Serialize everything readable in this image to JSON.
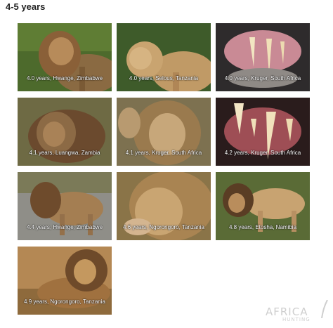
{
  "page": {
    "heading": "4-5 years"
  },
  "photos": [
    {
      "caption": "4.0 years, Hwange, Zimbabwe"
    },
    {
      "caption": "4.0 years, Selous, Tanzania"
    },
    {
      "caption": "4.0 years, Kruger, South Africa"
    },
    {
      "caption": "4.1 years, Luangwa, Zambia"
    },
    {
      "caption": "4.1 years, Kruger, South Africa"
    },
    {
      "caption": "4.2 years, Kruger, South Africa"
    },
    {
      "caption": "4.4 years, Hwange, Zimbabwe"
    },
    {
      "caption": "4.6 years, Ngorongoro, Tanzania"
    },
    {
      "caption": "4.8 years, Etosha, Namibia"
    },
    {
      "caption": "4.9 years, Ngorongoro, Tanzania"
    }
  ],
  "watermark": {
    "main": "AFRICA",
    "sub": "HUNTING"
  },
  "colors": {
    "heading": "#222222",
    "caption": "#ffffff",
    "watermark": "#cfcfcf"
  }
}
